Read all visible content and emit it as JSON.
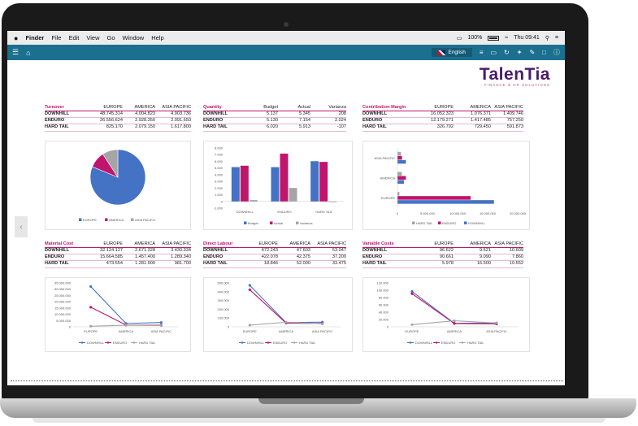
{
  "menubar": {
    "apple": "",
    "items": [
      "Finder",
      "File",
      "Edit",
      "View",
      "Go",
      "Window",
      "Help"
    ],
    "battery": "100%",
    "clock": "Thu 09:41"
  },
  "toolbar": {
    "language": "English"
  },
  "logo": {
    "name": "TalenTia",
    "tagline": "FINANCE & HR SOLUTIONS"
  },
  "colors": {
    "blue": "#4472c4",
    "magenta": "#c0156d",
    "grey": "#a5a5a5",
    "toolbar": "#1b6f8f"
  },
  "tables": {
    "turnover": {
      "title": "Turnover",
      "columns": [
        "EUROPE",
        "AMERICA",
        "ASIA PACIFIC"
      ],
      "rows": [
        {
          "label": "DOWNHILL",
          "values": [
            "48.745.314",
            "4.004.823",
            "4.903.736"
          ]
        },
        {
          "label": "ENDURO",
          "values": [
            "26.556.624",
            "2.928.350",
            "2.091.650"
          ]
        },
        {
          "label": "HARD TAIL",
          "values": [
            "825.170",
            "2.079.150",
            "1.617.800"
          ]
        }
      ]
    },
    "quantity": {
      "title": "Quantity",
      "columns": [
        "Budget",
        "Actual",
        "Varianza"
      ],
      "rows": [
        {
          "label": "DOWNHILL",
          "values": [
            "5.137",
            "5.345",
            "208"
          ]
        },
        {
          "label": "ENDURO",
          "values": [
            "5.130",
            "7.154",
            "2.024"
          ]
        },
        {
          "label": "HARD TAIL",
          "values": [
            "6.020",
            "5.913",
            "-107"
          ]
        }
      ]
    },
    "contribution_margin": {
      "title": "Contribution Margin",
      "columns": [
        "EUROPE",
        "AMERICA",
        "ASIA PACIFIC"
      ],
      "rows": [
        {
          "label": "DOWNHILL",
          "values": [
            "16.052.323",
            "1.076.371",
            "1.409.746"
          ]
        },
        {
          "label": "ENDURO",
          "values": [
            "12.179.271",
            "1.417.485",
            "757.250"
          ]
        },
        {
          "label": "HARD TAIL",
          "values": [
            "326.792",
            "729.450",
            "591.873"
          ]
        }
      ]
    },
    "material_cost": {
      "title": "Material Cost",
      "columns": [
        "EUROPE",
        "AMERICA",
        "ASIA PACIFIC"
      ],
      "rows": [
        {
          "label": "DOWNHILL",
          "values": [
            "32.124.127",
            "2.671.328",
            "3.430.334"
          ]
        },
        {
          "label": "ENDURO",
          "values": [
            "15.664.585",
            "1.457.400",
            "1.289.340"
          ]
        },
        {
          "label": "HARD TAIL",
          "values": [
            "473.554",
            "1.281.900",
            "981.700"
          ]
        }
      ]
    },
    "direct_labour": {
      "title": "Direct Labour",
      "columns": [
        "EUROPE",
        "AMERICA",
        "ASIA PACIFIC"
      ],
      "rows": [
        {
          "label": "DOWNHILL",
          "values": [
            "472.243",
            "47.603",
            "53.047"
          ]
        },
        {
          "label": "ENDURO",
          "values": [
            "422.078",
            "42.375",
            "37.200"
          ]
        },
        {
          "label": "HARD TAIL",
          "values": [
            "18.846",
            "52.000",
            "33.475"
          ]
        }
      ]
    },
    "variable_costs": {
      "title": "Variable Costs",
      "columns": [
        "EUROPE",
        "AMERICA",
        "ASIA PACIFIC"
      ],
      "rows": [
        {
          "label": "DOWNHILL",
          "values": [
            "96.622",
            "9.521",
            "10.609"
          ]
        },
        {
          "label": "ENDURO",
          "values": [
            "90.661",
            "9.090",
            "7.860"
          ]
        },
        {
          "label": "HARD TAIL",
          "values": [
            "5.978",
            "16.500",
            "10.552"
          ]
        }
      ]
    }
  },
  "chart_data": [
    {
      "type": "pie",
      "categories": [
        "EUROPE",
        "AMERICA",
        "ASIA PACIFIC"
      ],
      "values": [
        76127108,
        9012323,
        8613186
      ],
      "legend": [
        "EUROPE",
        "AMERICA",
        "ASIA PACIFIC"
      ]
    },
    {
      "type": "bar",
      "categories": [
        "DOWNHILL",
        "ENDURO",
        "HARD TAIL"
      ],
      "series": [
        {
          "name": "Budget",
          "values": [
            5137,
            5130,
            6020
          ]
        },
        {
          "name": "Actual",
          "values": [
            5345,
            7154,
            5913
          ]
        },
        {
          "name": "Varianza",
          "values": [
            208,
            2024,
            -107
          ]
        }
      ],
      "ylim": [
        -1000,
        8000
      ],
      "yticks": [
        "8.000",
        "7.000",
        "6.000",
        "5.000",
        "4.000",
        "3.000",
        "2.000",
        "1.000",
        "0",
        "-1.000"
      ]
    },
    {
      "type": "bar",
      "orientation": "horizontal",
      "categories": [
        "ASIA PACIFIC",
        "AMERICA",
        "EUROPE"
      ],
      "series": [
        {
          "name": "HARD TAIL",
          "values": [
            591873,
            729450,
            326792
          ]
        },
        {
          "name": "ENDURO",
          "values": [
            757250,
            1417485,
            12179271
          ]
        },
        {
          "name": "DOWNHILL",
          "values": [
            1409746,
            1076371,
            16052323
          ]
        }
      ],
      "xlim": [
        0,
        20000000
      ],
      "xticks": [
        "0",
        "5.000.000",
        "10.000.000",
        "15.000.000",
        "20.000.000"
      ]
    },
    {
      "type": "line",
      "categories": [
        "EUROPE",
        "AMERICA",
        "ASIA PACIFIC"
      ],
      "series": [
        {
          "name": "DOWNHILL",
          "values": [
            32124127,
            2671328,
            3430334
          ]
        },
        {
          "name": "ENDURO",
          "values": [
            15664585,
            1457400,
            1289340
          ]
        },
        {
          "name": "HARD TAIL",
          "values": [
            473554,
            1281900,
            981700
          ]
        }
      ],
      "ylim": [
        0,
        35000000
      ],
      "yticks": [
        "35.000.000",
        "30.000.000",
        "25.000.000",
        "20.000.000",
        "15.000.000",
        "10.000.000",
        "5.000.000",
        "0"
      ]
    },
    {
      "type": "line",
      "categories": [
        "EUROPE",
        "AMERICA",
        "ASIA PACIFIC"
      ],
      "series": [
        {
          "name": "DOWNHILL",
          "values": [
            472243,
            47603,
            53047
          ]
        },
        {
          "name": "ENDURO",
          "values": [
            422078,
            42375,
            37200
          ]
        },
        {
          "name": "HARD TAIL",
          "values": [
            18846,
            52000,
            33475
          ]
        }
      ],
      "ylim": [
        0,
        500000
      ],
      "yticks": [
        "500.000",
        "400.000",
        "300.000",
        "200.000",
        "100.000",
        "0"
      ]
    },
    {
      "type": "line",
      "categories": [
        "EUROPE",
        "AMERICA",
        "ASIA PACIFIC"
      ],
      "series": [
        {
          "name": "DOWNHILL",
          "values": [
            96622,
            9521,
            10609
          ]
        },
        {
          "name": "ENDURO",
          "values": [
            90661,
            9090,
            7860
          ]
        },
        {
          "name": "HARD TAIL",
          "values": [
            5978,
            16500,
            10552
          ]
        }
      ],
      "ylim": [
        0,
        120000
      ],
      "yticks": [
        "120.000",
        "100.000",
        "80.000",
        "60.000",
        "40.000",
        "20.000",
        "0"
      ]
    }
  ]
}
